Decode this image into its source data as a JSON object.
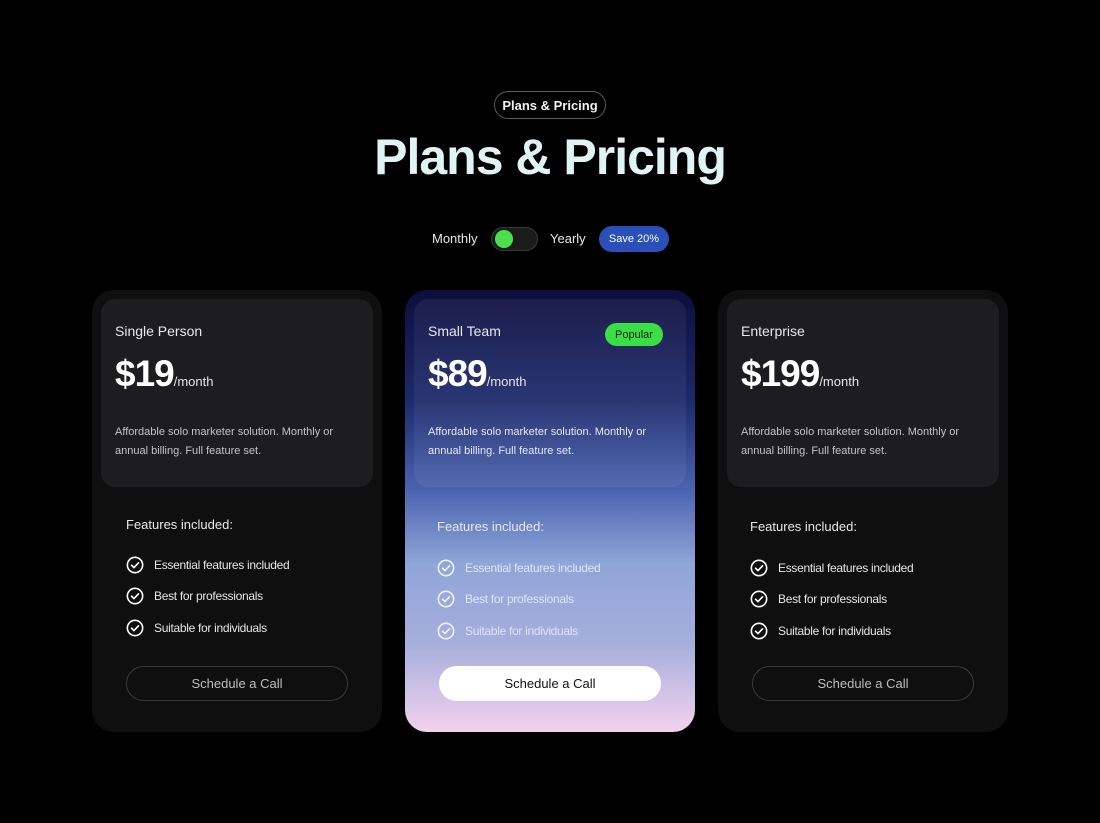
{
  "header": {
    "eyebrow": "Plans & Pricing",
    "title": "Plans & Pricing"
  },
  "billing": {
    "monthly_label": "Monthly",
    "yearly_label": "Yearly",
    "save_badge": "Save 20%",
    "toggle_state": "monthly"
  },
  "colors": {
    "accent_green": "#4be04e",
    "badge_blue": "#2a4fb8",
    "title_mint": "#dff4f3"
  },
  "plans": [
    {
      "name": "Single Person",
      "price": "$19",
      "period": "/month",
      "description": "Affordable solo marketer solution. Monthly or annual billing. Full feature set.",
      "features_title": "Features included:",
      "features": [
        "Essential features included",
        "Best for professionals",
        "Suitable for individuals"
      ],
      "cta": "Schedule a Call"
    },
    {
      "name": "Small Team",
      "badge": "Popular",
      "price": "$89",
      "period": "/month",
      "description": "Affordable solo marketer solution. Monthly or annual billing. Full feature set.",
      "features_title": "Features included:",
      "features": [
        "Essential features included",
        "Best for professionals",
        "Suitable for individuals"
      ],
      "cta": "Schedule a Call"
    },
    {
      "name": "Enterprise",
      "price": "$199",
      "period": "/month",
      "description": "Affordable solo marketer solution. Monthly or annual billing. Full feature set.",
      "features_title": "Features included:",
      "features": [
        "Essential features included",
        "Best for professionals",
        "Suitable for individuals"
      ],
      "cta": "Schedule a Call"
    }
  ],
  "icons": {
    "feature_check": "check-circle-icon"
  }
}
